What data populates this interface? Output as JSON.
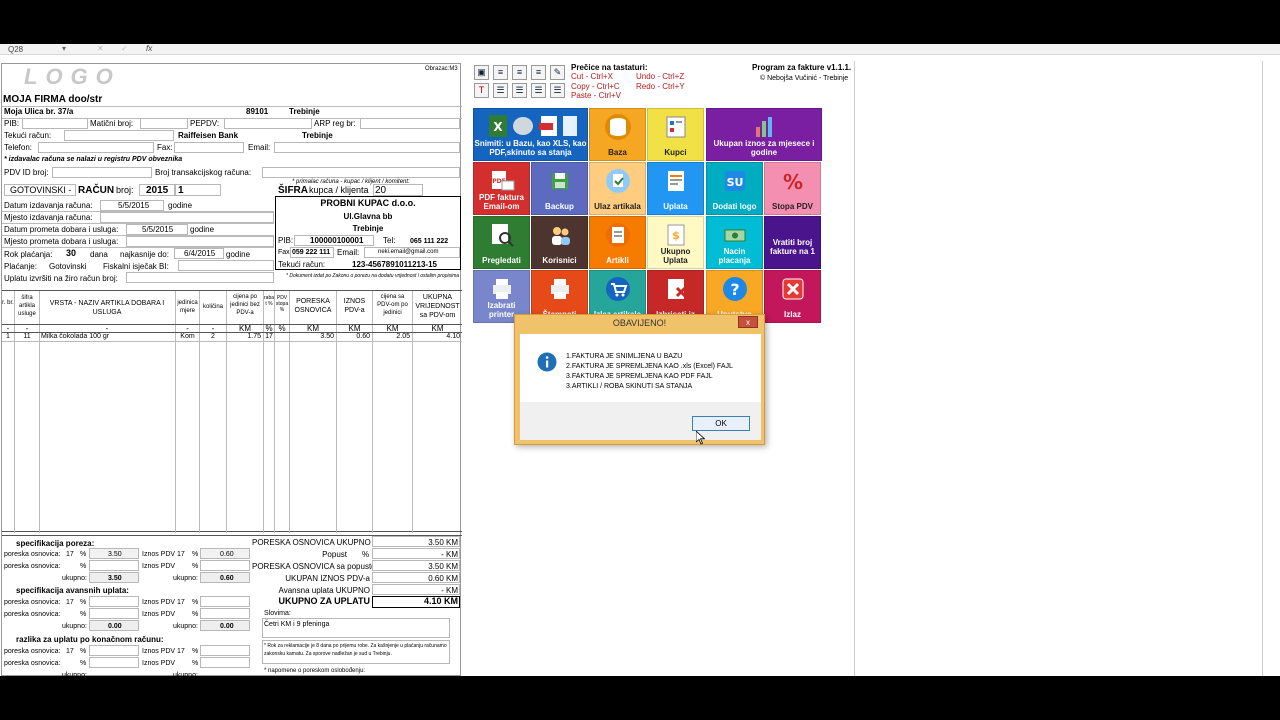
{
  "formula_bar": {
    "cell_ref": "Q28",
    "fx": "fx"
  },
  "invoice": {
    "logo_text": "LOGO",
    "form_code": "Obrazac:M3",
    "company_name": "MOJA FIRMA doo/str",
    "company_street": "Moja Ulica br. 37/a",
    "postal_code": "89101",
    "city": "Trebinje",
    "pib_label": "PIB:",
    "maticni_label": "Matični broj:",
    "pepdv_label": "PEPDV:",
    "arp_label": "ARP reg br:",
    "tekuci_label": "Tekući račun:",
    "bank": "Raiffeisen Bank",
    "bank_city": "Trebinje",
    "telefon_label": "Telefon:",
    "fax_label": "Fax:",
    "email_label": "Email:",
    "pdv_note": "* izdavalac računa se nalazi u registru PDV obveznika",
    "pdv_id_label": "PDV ID broj:",
    "transakcija_label": "Broj transakcijskog računa:",
    "primalac_note": "* primalac računa - kupac / klijent / komitent:",
    "payment_type": "GOTOVINSKI -",
    "racun_label": "RAČUN",
    "broj_label": "broj:",
    "year": "2015",
    "number": "1",
    "sifra_label": "ŠIFRA",
    "kupca_label": "kupca / klijenta",
    "client_code": "20",
    "rows": [
      {
        "label": "Datum izdavanja računa:",
        "value": "5/5/2015",
        "unit": "godine"
      },
      {
        "label": "Mjesto izdavanja računa:",
        "value": "",
        "unit": ""
      },
      {
        "label": "Datum prometa dobara i usluga:",
        "value": "5/5/2015",
        "unit": "godine"
      },
      {
        "label": "Mjesto prometa dobara i usluga:",
        "value": "",
        "unit": ""
      }
    ],
    "rok_label": "Rok plaćanja:",
    "rok_days": "30",
    "dana_label": "dana",
    "najkasnije_label": "najkasnije do:",
    "najkasnije_date": "6/4/2015",
    "najkasnije_unit": "godine",
    "placanje_label": "Plaćanje:",
    "placanje_value": "Gotovinski",
    "fiskalni_label": "Fiskalni isječak BI:",
    "uplatu_label": "Uplatu izvršiti na žiro račun broj:"
  },
  "client": {
    "name": "PROBNI KUPAC d.o.o.",
    "street": "Ul.Glavna bb",
    "city": "Trebinje",
    "pib_label": "PIB:",
    "pib": "100000100001",
    "tel_label": "Tel:",
    "tel": "065 111 222",
    "fax_label": "Fax:",
    "fax": "059 222 111",
    "email_label": "Email:",
    "email": "neki.email@gmail.com",
    "tekuci_label": "Tekući račun:",
    "tekuci": "123-4567891011213-15",
    "doc_note": "* Dokument izdat po Zakonu o porezu na dodatu vrijednost i ostalim propisima"
  },
  "table": {
    "headers": [
      "r. br.",
      "šifra artikla usluge",
      "VRSTA - NAZIV ARTIKLA DOBARA I USLUGA",
      "jedinica mjere",
      "količina",
      "cijena po jedinici bez PDV-a",
      "rabat %",
      "PDV stopa %",
      "PORESKA OSNOVICA",
      "IZNOS PDV-a",
      "cijena sa PDV-om po jedinici",
      "UKUPNA VRIJEDNOST sa PDV-om"
    ],
    "units": [
      "-",
      "-",
      "-",
      "-",
      "-",
      "KM",
      "%",
      "%",
      "KM",
      "KM",
      "KM",
      "KM"
    ],
    "row": [
      "1",
      "11",
      "Milka čokolada 100 gr",
      "Kom",
      "2",
      "1.75",
      "17",
      "",
      "3.50",
      "0.60",
      "2.05",
      "4.10"
    ]
  },
  "summary": {
    "spec_poreza": "specifikacija poreza:",
    "spec_avans": "specifikacija avansnih uplata:",
    "razlika": "razlika za uplatu po konačnom računu:",
    "poreska_osnovica": "poreska osnovica:",
    "iznos_pdv": "Iznos PDV",
    "ukupno": "ukupno:",
    "rate": "17",
    "pct": "%",
    "po_val": "3.50",
    "pdv_val": "0.60",
    "po_total": "3.50",
    "pdv_total": "0.60",
    "zero": "0.00",
    "tot_labels": [
      "PORESKA OSNOVICA UKUPNO",
      "Popust",
      "PORESKA OSNOVICA sa popustom",
      "UKUPAN IZNOS PDV-a",
      "Avansna uplata UKUPNO",
      "UKUPNO ZA UPLATU"
    ],
    "tot_values": [
      "3.50 KM",
      "- KM",
      "3.50 KM",
      "0.60 KM",
      "- KM",
      "4.10 KM"
    ],
    "popust_pct": "%",
    "slovima_label": "Slovima:",
    "slovima": "Četri KM i 9 pfeninga",
    "note1": "* Rok za reklamacije je 8 dana po prijemu robe. Za kašnjenje u plaćanju računamo zakonsku kamatu. Za sporove nadležan je sud u Trebinju.",
    "note2": "* napomene o poreskom oslobođenju:"
  },
  "toolbar": {
    "shortcuts_title": "Prečice na tastaturi:",
    "cut": "Cut - Ctrl+X",
    "copy": "Copy - Ctrl+C",
    "paste": "Paste - Ctrl+V",
    "undo": "Undo - Ctrl+Z",
    "redo": "Redo - Ctrl+Y",
    "program_title": "Program za fakture v1.1.1.",
    "author": "© Nebojša Vučinić - Trebinje"
  },
  "buttons": {
    "snimiti": "Snimiti: u Bazu, kao XLS, kao PDF,skinuto sa stanja",
    "baza": "Baza",
    "kupci": "Kupci",
    "ukupan": "Ukupan iznos za mjesece i godine",
    "pdf_email": "PDF faktura Email-om",
    "backup": "Backup",
    "ulaz": "Ulaz artikala",
    "uplata": "Uplata",
    "logo": "Dodati logo",
    "stopa": "Stopa PDV",
    "pregledati": "Pregledati",
    "korisnici": "Korisnici",
    "artikli": "Artikli",
    "ukupno_uplata": "Ukupno Uplata",
    "nacin": "Nacin placanja",
    "vratiti": "Vratiti broj fakture na 1",
    "izabrati": "Izabrati printer",
    "stampati": "Štampati",
    "izlaz_artikala": "Izlaz artikala",
    "izbrisati": "Izbrisati iz",
    "uputstvo": "Uputstvo",
    "izlaz": "Izlaz"
  },
  "dialog": {
    "title": "OBAVIJENO!",
    "close": "x",
    "lines": [
      "1.FAKTURA JE SNIMLJENA U BAZU",
      "2.FAKTURA JE SPREMLJENA KAO .xls (Excel) FAJL",
      "3.FAKTURA JE SPREMLJENA KAO PDF FAJL",
      "3.ARTIKLI / ROBA SKINUTI SA STANJA"
    ],
    "ok": "OK"
  },
  "colors": {
    "snimiti": "#1565c0",
    "baza": "#f5a623",
    "kupci": "#f2e144",
    "ukupan": "#7b1fa2",
    "pdf": "#d32f2f",
    "backup": "#5c6bc0",
    "ulaz": "#ffcc80",
    "uplata": "#2196f3",
    "logo": "#00acc1",
    "stopa": "#f48fb1",
    "pregledati": "#2e7d32",
    "korisnici": "#4e342e",
    "artikli": "#f57c00",
    "ukupno_uplata": "#fff9c4",
    "nacin": "#00bcd4",
    "vratiti": "#4a148c",
    "izabrati": "#7986cb",
    "stampati": "#e64a19",
    "izlaz_art": "#26a69a",
    "izbrisati": "#c62828",
    "uputstvo": "#f9a825",
    "izlaz": "#c2185b"
  }
}
